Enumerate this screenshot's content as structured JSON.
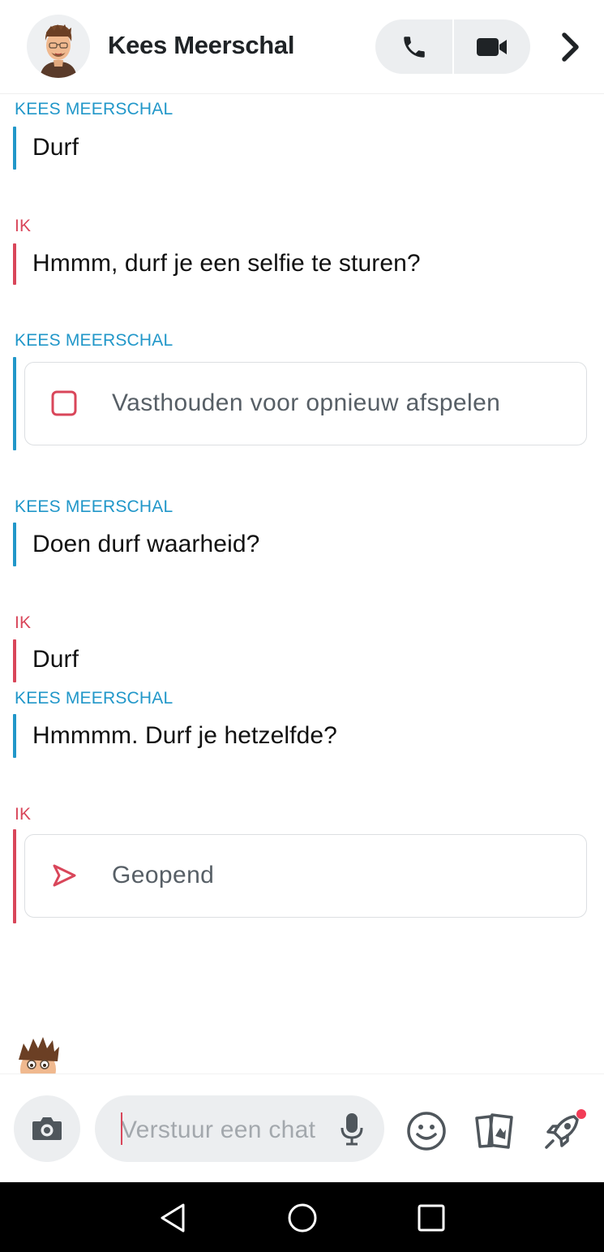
{
  "header": {
    "contact_name": "Kees Meerschal",
    "call_icon": "phone-icon",
    "video_icon": "video-camera-icon",
    "more_icon": "chevron-right-icon"
  },
  "messages": [
    {
      "sender": "KEES MEERSCHAL",
      "type": "text",
      "text": "Durf"
    },
    {
      "sender": "IK",
      "type": "text",
      "text": "Hmmm, durf je een selfie te sturen?"
    },
    {
      "sender": "KEES MEERSCHAL",
      "type": "snap",
      "text": "Vasthouden voor opnieuw afspelen",
      "icon": "square-snap-icon"
    },
    {
      "sender": "KEES MEERSCHAL",
      "type": "text",
      "text": "Doen durf waarheid?"
    },
    {
      "sender": "IK",
      "type": "text",
      "text": "Durf"
    },
    {
      "sender": "KEES MEERSCHAL",
      "type": "text",
      "text": "Hmmmm. Durf je hetzelfde?"
    },
    {
      "sender": "IK",
      "type": "snap",
      "text": "Geopend",
      "icon": "sent-arrow-icon"
    }
  ],
  "input_bar": {
    "placeholder": "Verstuur een chat",
    "camera_icon": "camera-icon",
    "mic_icon": "microphone-icon",
    "emoji_icon": "smiley-icon",
    "stickers_icon": "cards-icon",
    "games_icon": "rocket-icon"
  },
  "colors": {
    "them": "#2197c9",
    "me": "#d9465a",
    "notification": "#f23c57"
  },
  "nav": {
    "back_icon": "back-triangle-icon",
    "home_icon": "home-circle-icon",
    "recents_icon": "recents-square-icon"
  }
}
